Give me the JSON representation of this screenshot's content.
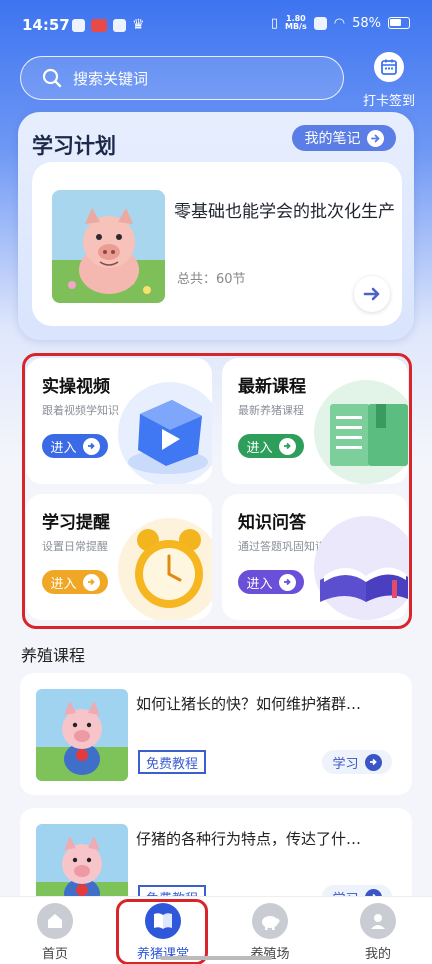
{
  "status_bar": {
    "time": "14:57",
    "speed_value": "1.80",
    "speed_unit": "MB/s",
    "battery": "58%"
  },
  "search": {
    "placeholder": "搜索关键词",
    "icon": "search-icon"
  },
  "checkin": {
    "label": "打卡签到",
    "icon": "calendar-icon"
  },
  "plan": {
    "title": "学习计划",
    "notes_label": "我的笔记",
    "course_title": "零基础也能学会的批次化生产",
    "course_count": "总共：60节"
  },
  "features": [
    {
      "name": "实操视频",
      "sub": "跟着视频学知识",
      "btn": "进入",
      "color": "#3b6ae6"
    },
    {
      "name": "最新课程",
      "sub": "最新养猪课程",
      "btn": "进入",
      "color": "#2e9e5b"
    },
    {
      "name": "学习提醒",
      "sub": "设置日常提醒",
      "btn": "进入",
      "color": "#f0a726"
    },
    {
      "name": "知识问答",
      "sub": "通过答题巩固知识",
      "btn": "进入",
      "color": "#6a4fd9"
    }
  ],
  "courses_section": {
    "title": "养殖课程",
    "items": [
      {
        "name": "如何让猪长的快？如何维护猪群…",
        "tag": "免费教程",
        "action": "学习"
      },
      {
        "name": "仔猪的各种行为特点，传达了什…",
        "tag": "免费教程",
        "action": "学习"
      }
    ]
  },
  "tabs": [
    {
      "label": "首页",
      "icon": "home-icon"
    },
    {
      "label": "养猪课堂",
      "icon": "book-icon"
    },
    {
      "label": "养殖场",
      "icon": "piggy-icon"
    },
    {
      "label": "我的",
      "icon": "user-icon"
    }
  ],
  "colors": {
    "primary": "#3d74f0",
    "highlight_border": "#d9242a"
  }
}
